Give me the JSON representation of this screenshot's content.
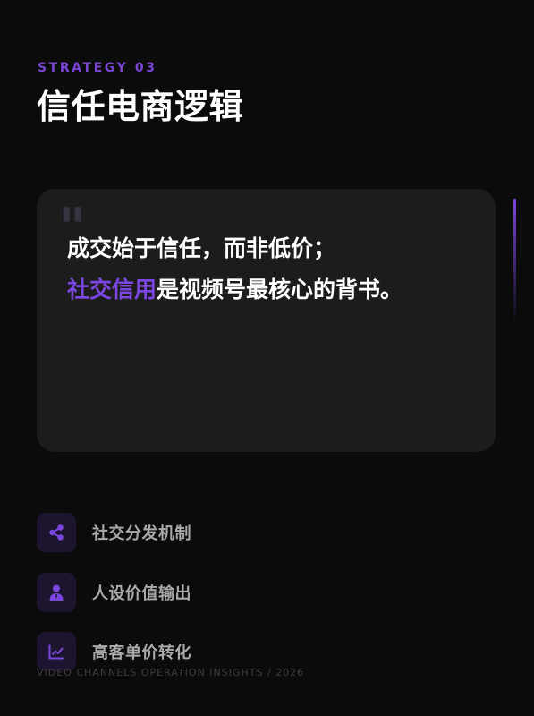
{
  "header": {
    "label": "STRATEGY 03",
    "title": "信任电商逻辑"
  },
  "quote": {
    "mark": "\"",
    "line1": "成交始于信任，而非低价；",
    "line2_highlight": "社交信用",
    "line2_rest": "是视频号最核心的背书。"
  },
  "features": [
    {
      "icon": "share-icon",
      "label": "社交分发机制"
    },
    {
      "icon": "user-tie-icon",
      "label": "人设价值输出"
    },
    {
      "icon": "chart-line-icon",
      "label": "高客单价转化"
    }
  ],
  "footer": {
    "text": "VIDEO CHANNELS OPERATION INSIGHTS / 2026"
  },
  "colors": {
    "accent": "#7b45e0",
    "background": "#0b0b0c",
    "card": "#1c1c1d",
    "icon_bg": "#1d1530"
  }
}
